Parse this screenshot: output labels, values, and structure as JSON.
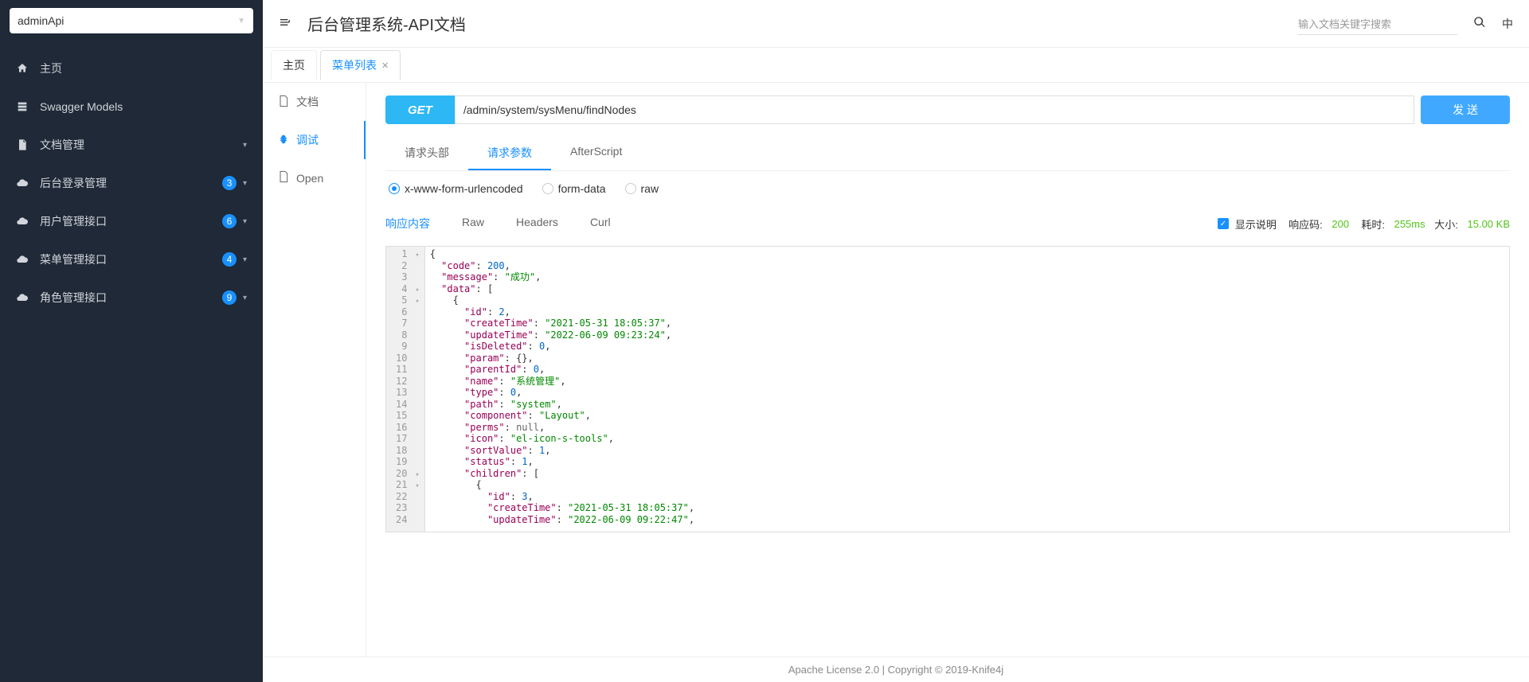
{
  "apiSelect": "adminApi",
  "sidebar": [
    {
      "icon": "home",
      "label": "主页"
    },
    {
      "icon": "models",
      "label": "Swagger Models"
    },
    {
      "icon": "doc",
      "label": "文档管理",
      "arrow": true
    },
    {
      "icon": "cloud",
      "label": "后台登录管理",
      "badge": "3",
      "arrow": true
    },
    {
      "icon": "cloud",
      "label": "用户管理接口",
      "badge": "6",
      "arrow": true
    },
    {
      "icon": "cloud",
      "label": "菜单管理接口",
      "badge": "4",
      "arrow": true
    },
    {
      "icon": "cloud",
      "label": "角色管理接口",
      "badge": "9",
      "arrow": true
    }
  ],
  "title": "后台管理系统-API文档",
  "searchPlaceholder": "输入文档关键字搜索",
  "lang": "中",
  "tabs": [
    {
      "label": "主页",
      "closable": false
    },
    {
      "label": "菜单列表",
      "closable": true,
      "active": true
    }
  ],
  "leftPanel": [
    {
      "icon": "file",
      "label": "文档"
    },
    {
      "icon": "bug",
      "label": "调试",
      "active": true
    },
    {
      "icon": "file",
      "label": "Open"
    }
  ],
  "method": "GET",
  "url": "/admin/system/sysMenu/findNodes",
  "sendBtn": "发 送",
  "reqTabs": [
    {
      "label": "请求头部"
    },
    {
      "label": "请求参数",
      "active": true
    },
    {
      "label": "AfterScript"
    }
  ],
  "bodyTypes": [
    {
      "label": "x-www-form-urlencoded",
      "active": true
    },
    {
      "label": "form-data"
    },
    {
      "label": "raw"
    }
  ],
  "respTabs": [
    {
      "label": "响应内容",
      "active": true
    },
    {
      "label": "Raw"
    },
    {
      "label": "Headers"
    },
    {
      "label": "Curl"
    }
  ],
  "showDesc": "显示说明",
  "respMeta": {
    "codeLabel": "响应码:",
    "code": "200",
    "timeLabel": "耗时:",
    "time": "255ms",
    "sizeLabel": "大小:",
    "size": "15.00 KB"
  },
  "json": {
    "code": 200,
    "message": "成功",
    "data": [
      {
        "id": 2,
        "createTime": "2021-05-31 18:05:37",
        "updateTime": "2022-06-09 09:23:24",
        "isDeleted": 0,
        "param": {},
        "parentId": 0,
        "name": "系统管理",
        "type": 0,
        "path": "system",
        "component": "Layout",
        "perms": null,
        "icon": "el-icon-s-tools",
        "sortValue": 1,
        "status": 1,
        "children": [
          {
            "id": 3,
            "createTime": "2021-05-31 18:05:37",
            "updateTime": "2022-06-09 09:22:47"
          }
        ]
      }
    ]
  },
  "footer": "Apache License 2.0 | Copyright © 2019-Knife4j"
}
